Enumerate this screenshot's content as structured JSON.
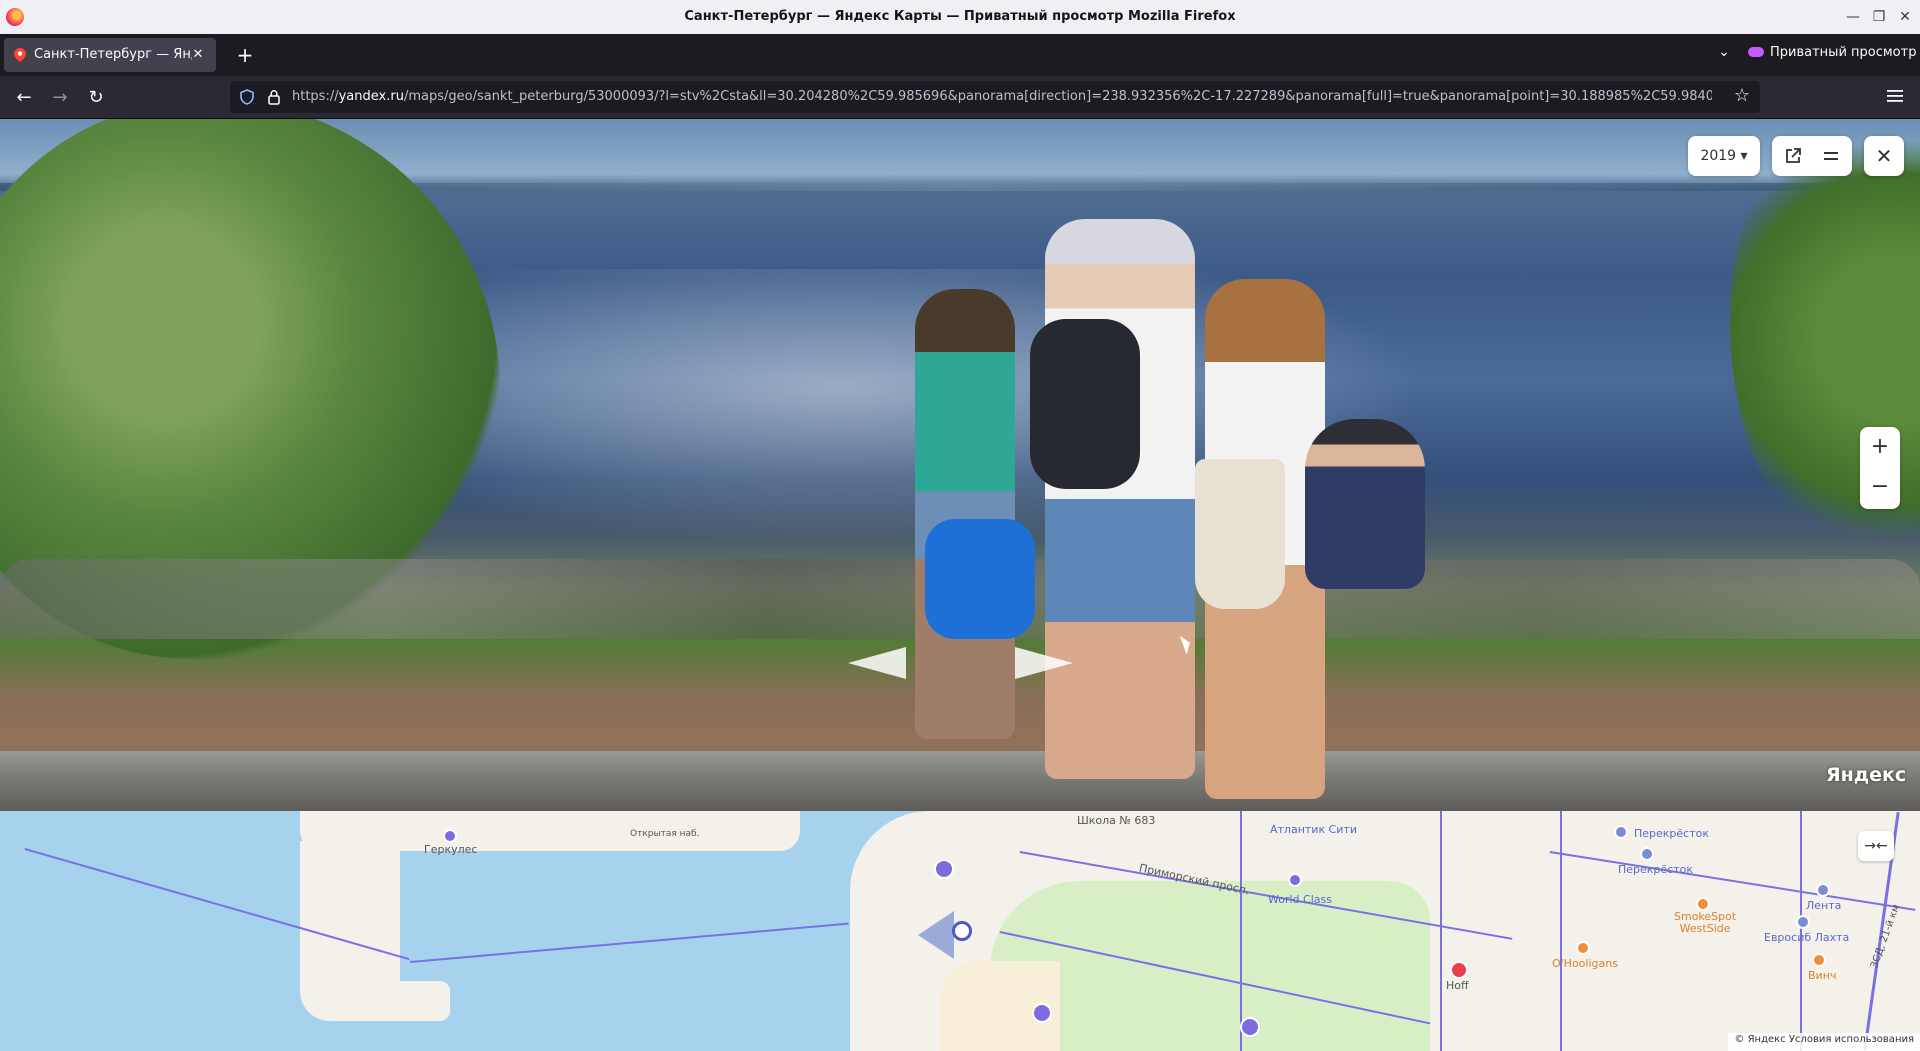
{
  "window": {
    "title": "Санкт-Петербург — Яндекс Карты — Приватный просмотр Mozilla Firefox"
  },
  "tabs": [
    {
      "label": "Санкт-Петербург — Яндекс Карты",
      "close": "✕"
    }
  ],
  "tabstrip": {
    "new_tab": "+",
    "list_all": "⌄",
    "private_label": "Приватный просмотр"
  },
  "nav": {
    "back": "←",
    "forward": "→",
    "reload": "↻",
    "url_domain": "yandex.ru",
    "url_prefix": "https://",
    "url_path": "/maps/geo/sankt_peterburg/53000093/?l=stv%2Csta&ll=30.204280%2C59.985696&panorama[direction]=238.932356%2C-17.227289&panorama[full]=true&panorama[point]=30.188985%2C59.984092&panorama",
    "bookmark": "☆"
  },
  "panorama": {
    "year": "2019 ▾",
    "close": "✕",
    "zoom_in": "+",
    "zoom_out": "−",
    "logo": "Яндекс"
  },
  "map": {
    "labels": {
      "herkules": "Геркулес",
      "otkrytaya": "Открытая наб.",
      "school": "Школа № 683",
      "atlantic": "Атлантик Сити",
      "primorsky": "Приморский просп.",
      "world_class": "World Class",
      "perekrestok1": "Перекрёсток",
      "perekrestok2": "Перекрёсток",
      "lenta": "Лента",
      "smokespot": "SmokeSpot\nWestSide",
      "evrosib": "Евросиб Лахта",
      "ohooligans": "O'Hooligans",
      "hoff": "Hoff",
      "vinch": "Винч",
      "zsd": "ЗСД, 21-й км"
    },
    "expand": "→←",
    "copyright": "© Яндекс   Условия использования"
  },
  "colors": {
    "accent": "#7b6fe6",
    "water": "#a6d2ee",
    "park": "#d8efc5"
  }
}
